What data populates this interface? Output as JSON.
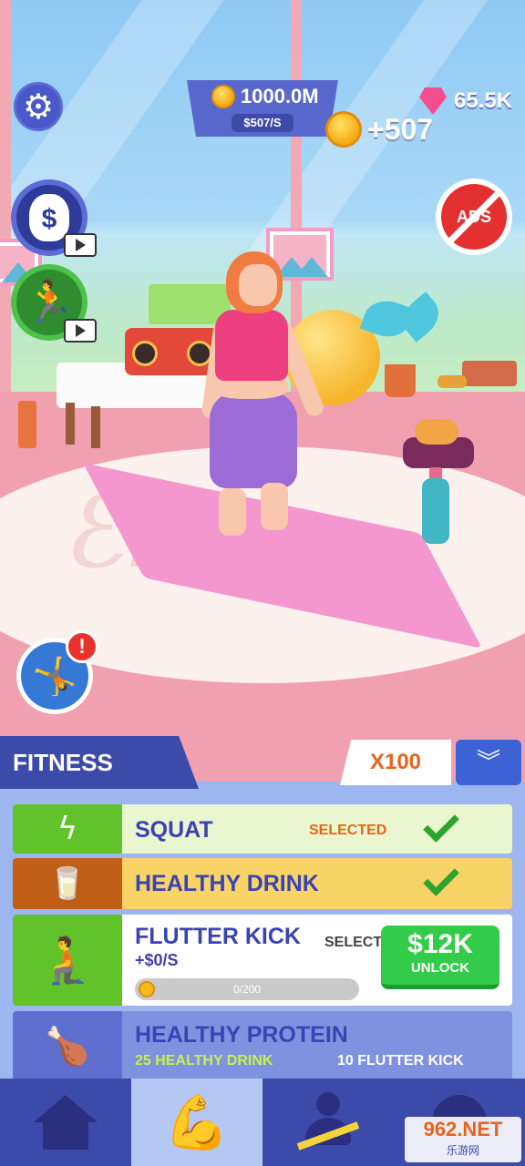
{
  "hud": {
    "money": "1000.0M",
    "money_rate": "$507/S",
    "gems": "65.5K",
    "income_popup": "+507",
    "no_ads_label": "ADS",
    "money_bag_symbol": "$",
    "alert_symbol": "!"
  },
  "panel": {
    "tab_label": "FITNESS",
    "multiplier_label": "X100",
    "exercises": [
      {
        "title": "SQUAT",
        "status": "SELECTED",
        "icon": "squat-icon",
        "color": "#62c22a"
      },
      {
        "title": "HEALTHY DRINK",
        "icon": "drink-bottle-icon",
        "color": "#c05e16"
      },
      {
        "title": "FLUTTER KICK",
        "rate": "+$0/S",
        "action": "SELECT",
        "progress": "0/200",
        "progress_value": 0,
        "progress_max": 200,
        "unlock_price": "$12K",
        "unlock_label": "UNLOCK",
        "icon": "flutter-kick-icon",
        "color": "#62c22a"
      },
      {
        "title": "HEALTHY PROTEIN",
        "requirement_1": "25 HEALTHY DRINK",
        "requirement_2": "10 FLUTTER KICK",
        "icon": "protein-food-icon",
        "color": "#5f6fcf"
      }
    ]
  },
  "bottom_nav": {
    "items": [
      "home-icon",
      "muscle-arm-icon",
      "trainer-growth-icon",
      "character-icon"
    ],
    "active_index": 1
  },
  "watermark": {
    "main": "962.NET",
    "sub": "乐游网"
  },
  "colors": {
    "panel_blue": "#3c4aa9",
    "accent_orange": "#e8641a",
    "unlock_green": "#33cc4a"
  }
}
